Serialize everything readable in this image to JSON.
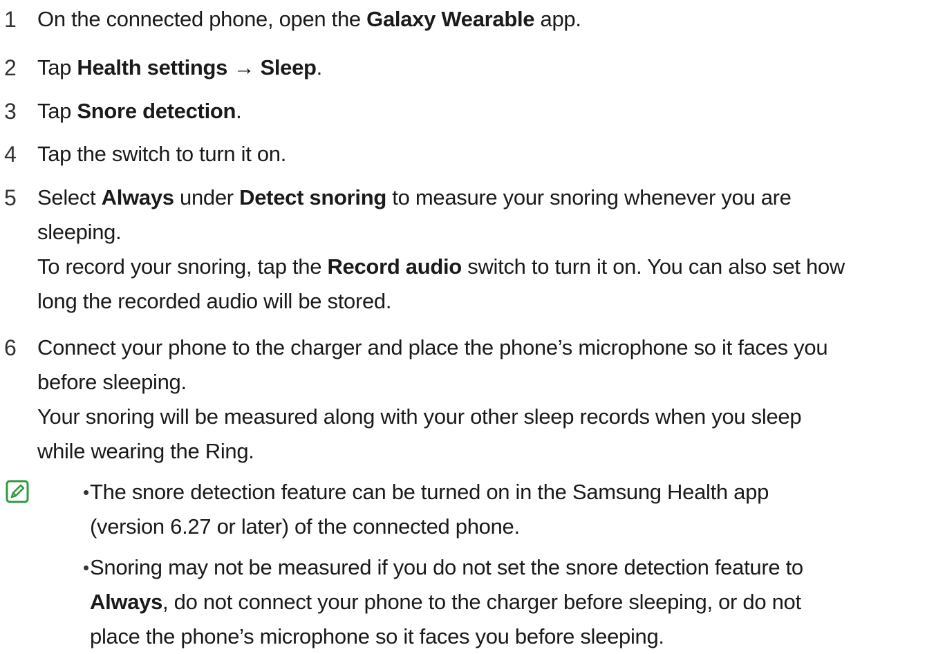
{
  "steps": [
    {
      "num": "1",
      "lines": [
        [
          {
            "t": "On the connected phone, open the ",
            "b": false
          },
          {
            "t": "Galaxy Wearable",
            "b": true
          },
          {
            "t": " app.",
            "b": false
          }
        ]
      ]
    },
    {
      "num": "2",
      "lines": [
        [
          {
            "t": "Tap ",
            "b": false
          },
          {
            "t": "Health settings",
            "b": true
          },
          {
            "t": " → ",
            "b": false
          },
          {
            "t": "Sleep",
            "b": true
          },
          {
            "t": ".",
            "b": false
          }
        ]
      ]
    },
    {
      "num": "3",
      "lines": [
        [
          {
            "t": "Tap ",
            "b": false
          },
          {
            "t": "Snore detection",
            "b": true
          },
          {
            "t": ".",
            "b": false
          }
        ]
      ]
    },
    {
      "num": "4",
      "lines": [
        [
          {
            "t": "Tap the switch to turn it on.",
            "b": false
          }
        ]
      ]
    },
    {
      "num": "5",
      "lines": [
        [
          {
            "t": "Select ",
            "b": false
          },
          {
            "t": "Always",
            "b": true
          },
          {
            "t": " under ",
            "b": false
          },
          {
            "t": "Detect snoring",
            "b": true
          },
          {
            "t": " to measure your snoring whenever you are",
            "b": false
          }
        ],
        [
          {
            "t": "sleeping.",
            "b": false
          }
        ],
        [
          {
            "t": "To record your snoring, tap the ",
            "b": false
          },
          {
            "t": "Record audio",
            "b": true
          },
          {
            "t": " switch to turn it on. You can also set how",
            "b": false
          }
        ],
        [
          {
            "t": "long the recorded audio will be stored.",
            "b": false
          }
        ]
      ]
    },
    {
      "num": "6",
      "lines": [
        [
          {
            "t": "Connect your phone to the charger and place the phone’s microphone so it faces you",
            "b": false
          }
        ],
        [
          {
            "t": "before sleeping.",
            "b": false
          }
        ],
        [
          {
            "t": "Your snoring will be measured along with your other sleep records when you sleep",
            "b": false
          }
        ],
        [
          {
            "t": "while wearing the Ring.",
            "b": false
          }
        ]
      ]
    }
  ],
  "notes": {
    "icon": "note-pencil-icon",
    "accent": "#2e9b3f",
    "bullets": [
      {
        "lines": [
          [
            {
              "t": "The snore detection feature can be turned on in the Samsung Health app",
              "b": false
            }
          ],
          [
            {
              "t": "(version 6.27 or later) of the connected phone.",
              "b": false
            }
          ]
        ]
      },
      {
        "lines": [
          [
            {
              "t": "Snoring may not be measured if you do not set the snore detection feature to",
              "b": false
            }
          ],
          [
            {
              "t": "Always",
              "b": true
            },
            {
              "t": ", do not connect your phone to the charger before sleeping, or do not",
              "b": false
            }
          ],
          [
            {
              "t": "place the phone’s microphone so it faces you before sleeping.",
              "b": false
            }
          ]
        ]
      }
    ]
  }
}
